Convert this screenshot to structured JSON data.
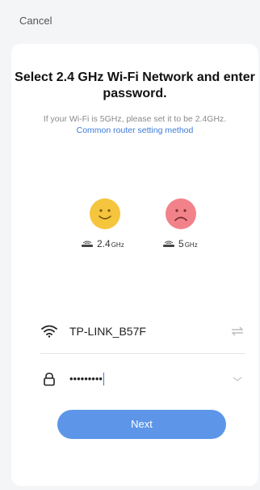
{
  "header": {
    "cancel_label": "Cancel"
  },
  "title": "Select 2.4 GHz Wi-Fi Network and enter password.",
  "subtitle": {
    "text": "If your Wi-Fi is 5GHz, please set it to be 2.4GHz.",
    "link": "Common router setting method"
  },
  "bands": [
    {
      "value": "2.4",
      "unit": "GHz",
      "status": "supported",
      "face": "happy-face-icon"
    },
    {
      "value": "5",
      "unit": "GHz",
      "status": "unsupported",
      "face": "sad-face-icon"
    }
  ],
  "wifi": {
    "ssid": "TP-LINK_B57F"
  },
  "password": {
    "masked": "•••••••••"
  },
  "buttons": {
    "next": "Next"
  },
  "colors": {
    "accent": "#5d96e8",
    "link": "#3d7bd8",
    "happy": "#f5c53d",
    "sad": "#f2828a"
  }
}
